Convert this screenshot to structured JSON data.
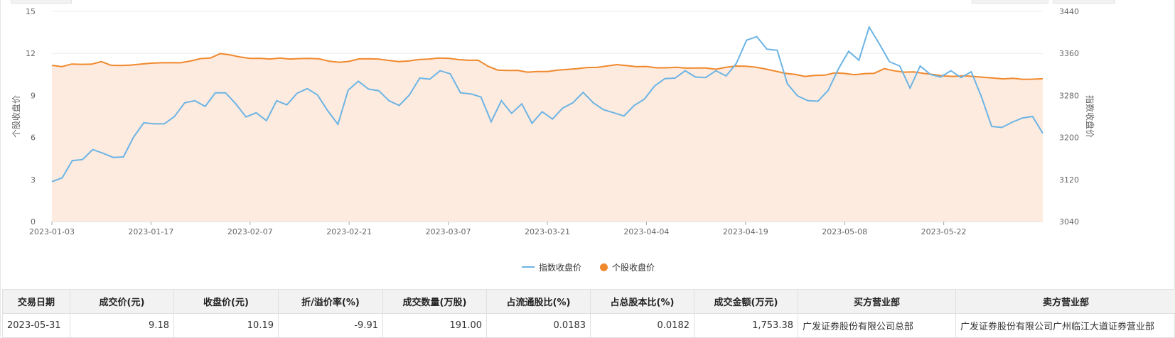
{
  "chart_data": {
    "type": "line",
    "x_ticks": [
      "2023-01-03",
      "2023-01-17",
      "2023-02-07",
      "2023-02-21",
      "2023-03-07",
      "2023-03-21",
      "2023-04-04",
      "2023-04-19",
      "2023-05-08",
      "2023-05-22"
    ],
    "x_tick_index": [
      0,
      10,
      20,
      30,
      40,
      50,
      60,
      70,
      80,
      90
    ],
    "left_axis": {
      "label": "个股收盘价",
      "min": 0,
      "max": 15,
      "ticks": [
        "0",
        "3",
        "6",
        "9",
        "12",
        "15"
      ]
    },
    "right_axis": {
      "label": "指数收盘价",
      "min": 3040,
      "max": 3440,
      "ticks": [
        "3040",
        "3120",
        "3200",
        "3280",
        "3360",
        "3440"
      ]
    },
    "series": [
      {
        "name": "指数收盘价",
        "axis": "right",
        "color": "#6cb4e4",
        "style": "line",
        "values": [
          3116,
          3123,
          3156,
          3158,
          3177,
          3170,
          3162,
          3163,
          3201,
          3228,
          3226,
          3226,
          3240,
          3266,
          3270,
          3259,
          3285,
          3285,
          3264,
          3239,
          3247,
          3232,
          3270,
          3262,
          3284,
          3293,
          3281,
          3251,
          3225,
          3290,
          3307,
          3292,
          3289,
          3270,
          3261,
          3281,
          3313,
          3311,
          3327,
          3321,
          3285,
          3283,
          3277,
          3230,
          3270,
          3246,
          3264,
          3227,
          3249,
          3235,
          3256,
          3266,
          3286,
          3266,
          3253,
          3247,
          3241,
          3261,
          3273,
          3298,
          3312,
          3313,
          3327,
          3315,
          3314,
          3327,
          3317,
          3341,
          3385,
          3392,
          3368,
          3366,
          3302,
          3279,
          3270,
          3269,
          3290,
          3331,
          3364,
          3347,
          3410,
          3378,
          3344,
          3336,
          3294,
          3336,
          3320,
          3315,
          3327,
          3314,
          3325,
          3277,
          3221,
          3219,
          3229,
          3237,
          3240,
          3208
        ]
      },
      {
        "name": "个股收盘价",
        "axis": "left",
        "color": "#f0892d",
        "style": "area",
        "fill": "#fdebe0",
        "values": [
          11.15,
          11.05,
          11.24,
          11.22,
          11.23,
          11.41,
          11.15,
          11.14,
          11.17,
          11.24,
          11.3,
          11.33,
          11.34,
          11.33,
          11.46,
          11.63,
          11.67,
          11.99,
          11.89,
          11.74,
          11.64,
          11.65,
          11.6,
          11.67,
          11.6,
          11.63,
          11.64,
          11.61,
          11.44,
          11.36,
          11.43,
          11.61,
          11.62,
          11.59,
          11.5,
          11.41,
          11.46,
          11.56,
          11.59,
          11.67,
          11.65,
          11.56,
          11.51,
          11.52,
          11.09,
          10.81,
          10.78,
          10.79,
          10.66,
          10.71,
          10.71,
          10.8,
          10.86,
          10.91,
          10.99,
          11.0,
          11.1,
          11.2,
          11.13,
          11.05,
          11.07,
          10.97,
          10.97,
          11.01,
          10.95,
          10.96,
          10.96,
          10.87,
          11.0,
          11.1,
          11.09,
          11.02,
          10.89,
          10.74,
          10.58,
          10.5,
          10.36,
          10.43,
          10.45,
          10.61,
          10.57,
          10.48,
          10.55,
          10.58,
          10.91,
          10.76,
          10.66,
          10.68,
          10.57,
          10.49,
          10.39,
          10.36,
          10.41,
          10.36,
          10.29,
          10.24,
          10.18,
          10.22,
          10.15,
          10.16,
          10.19
        ]
      }
    ]
  },
  "legend": {
    "index_label": "指数收盘价",
    "stock_label": "个股收盘价"
  },
  "table": {
    "headers": [
      "交易日期",
      "成交价(元)",
      "收盘价(元)",
      "折/溢价率(%)",
      "成交数量(万股)",
      "占流通股比(%)",
      "占总股本比(%)",
      "成交金额(万元)",
      "买方营业部",
      "卖方营业部"
    ],
    "rows": [
      [
        "2023-05-31",
        "9.18",
        "10.19",
        "-9.91",
        "191.00",
        "0.0183",
        "0.0182",
        "1,753.38",
        "广发证券股份有限公司总部",
        "广发证券股份有限公司广州临江大道证券营业部"
      ]
    ]
  }
}
